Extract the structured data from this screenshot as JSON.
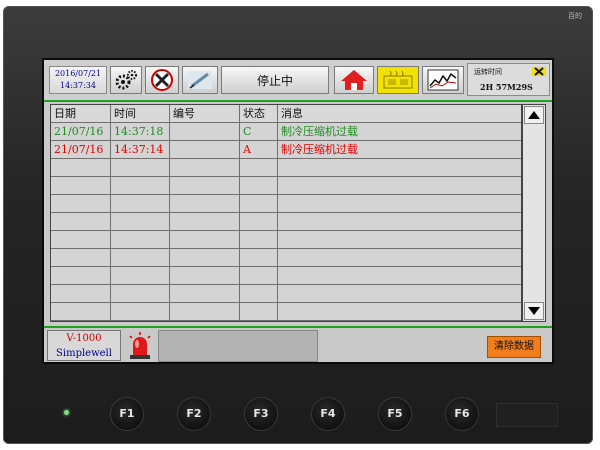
{
  "device": {
    "brand": "百的",
    "model": "V-1000",
    "maker": "Simplewell"
  },
  "topbar": {
    "date": "2016/07/21",
    "time": "14:37:34",
    "status_label": "停止中",
    "runtime_label": "运转时间",
    "runtime_value": "2H 57M29S",
    "icons": [
      "gear-icon",
      "tools-icon",
      "pen-icon",
      "home-icon",
      "machine-icon",
      "trend-chart-icon"
    ]
  },
  "table": {
    "columns": [
      "日期",
      "时间",
      "编号",
      "状态",
      "消息"
    ],
    "rows": [
      {
        "date": "21/07/16",
        "time": "14:37:18",
        "id": "",
        "state": "C",
        "message": "制冷压缩机过载",
        "color": "#1f8a1f"
      },
      {
        "date": "21/07/16",
        "time": "14:37:14",
        "id": "",
        "state": "A",
        "message": "制冷压缩机过载",
        "color": "#e00000"
      }
    ]
  },
  "bottom": {
    "clear_label": "清除数据"
  },
  "keys": [
    "F1",
    "F2",
    "F3",
    "F4",
    "F5",
    "F6"
  ],
  "colors": {
    "accent_green": "#1ea21e",
    "clear_button": "#f07e1c",
    "home_red": "#e02020",
    "machine_yellow": "#f2e200"
  }
}
